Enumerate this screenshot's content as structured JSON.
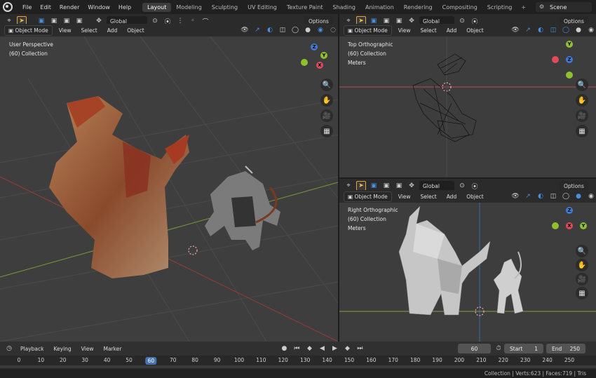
{
  "menus": [
    "File",
    "Edit",
    "Render",
    "Window",
    "Help"
  ],
  "workspaces": [
    "Layout",
    "Modeling",
    "Sculpting",
    "UV Editing",
    "Texture Paint",
    "Shading",
    "Animation",
    "Rendering",
    "Compositing",
    "Scripting"
  ],
  "active_workspace": "Layout",
  "scene": "Scene",
  "viewport_header": {
    "orientation": "Global",
    "mode": "Object Mode",
    "menus": [
      "View",
      "Select",
      "Add",
      "Object"
    ],
    "options": "Options"
  },
  "viewports": [
    {
      "view": "User Perspective",
      "collection": "(60) Collection"
    },
    {
      "view": "Top Orthographic",
      "collection": "(60) Collection",
      "units": "Meters"
    },
    {
      "view": "Right Orthographic",
      "collection": "(60) Collection",
      "units": "Meters"
    }
  ],
  "gizmo_axes": [
    "X",
    "Y",
    "Z"
  ],
  "timeline": {
    "playback": "Playback",
    "keying": "Keying",
    "view": "View",
    "marker": "Marker",
    "current_frame": "60",
    "start_label": "Start",
    "start": "1",
    "end_label": "End",
    "end": "250"
  },
  "ruler_ticks": [
    "0",
    "10",
    "20",
    "30",
    "40",
    "50",
    "60",
    "70",
    "80",
    "90",
    "100",
    "110",
    "120",
    "130",
    "140",
    "150",
    "160",
    "170",
    "180",
    "190",
    "200",
    "210",
    "220",
    "230",
    "240",
    "250"
  ],
  "status": "Collection | Verts:623 | Faces:719 | Tris"
}
